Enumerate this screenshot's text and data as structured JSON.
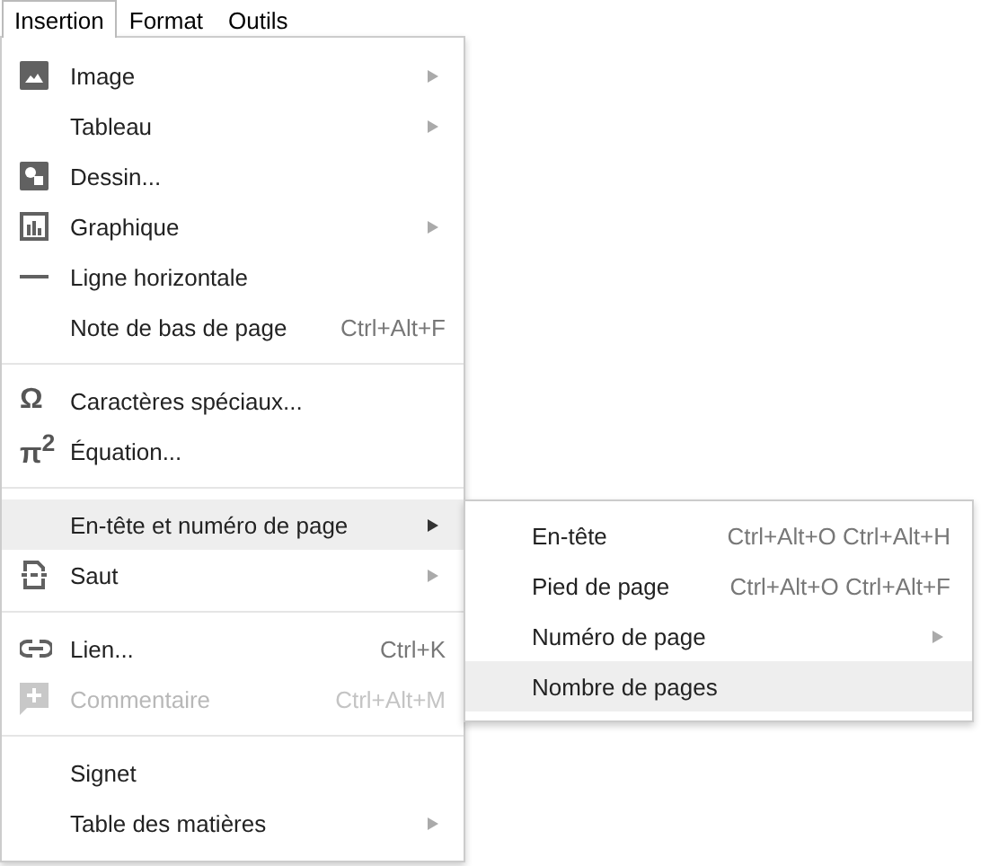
{
  "menubar": [
    {
      "label": "Insertion",
      "selected": true
    },
    {
      "label": "Format",
      "selected": false
    },
    {
      "label": "Outils",
      "selected": false
    }
  ],
  "menu": {
    "groups": [
      [
        {
          "label": "Image",
          "submenu": true,
          "selected": false,
          "disabled": false
        },
        {
          "label": "Tableau",
          "submenu": true,
          "selected": false,
          "disabled": false
        },
        {
          "label": "Dessin...",
          "submenu": false,
          "selected": false,
          "disabled": false
        },
        {
          "label": "Graphique",
          "submenu": true,
          "selected": false,
          "disabled": false
        },
        {
          "label": "Ligne horizontale",
          "submenu": false,
          "selected": false,
          "disabled": false
        },
        {
          "label": "Note de bas de page",
          "shortcut": "Ctrl+Alt+F",
          "submenu": false,
          "selected": false,
          "disabled": false
        }
      ],
      [
        {
          "label": "Caractères spéciaux...",
          "glyph": "Ω",
          "submenu": false,
          "selected": false,
          "disabled": false
        },
        {
          "label": "Équation...",
          "glyph": "π$^{2}$",
          "submenu": false,
          "selected": false,
          "disabled": false
        }
      ],
      [
        {
          "label": "En-tête et numéro de page",
          "submenu": true,
          "selected": true,
          "disabled": false
        },
        {
          "label": "Saut",
          "submenu": true,
          "selected": false,
          "disabled": false
        }
      ],
      [
        {
          "label": "Lien...",
          "shortcut": "Ctrl+K",
          "submenu": false,
          "selected": false,
          "disabled": false
        },
        {
          "label": "Commentaire",
          "shortcut": "Ctrl+Alt+M",
          "submenu": false,
          "selected": false,
          "disabled": true
        }
      ],
      [
        {
          "label": "Signet",
          "submenu": false,
          "selected": false,
          "disabled": false
        },
        {
          "label": "Table des matières",
          "submenu": true,
          "selected": false,
          "disabled": false
        }
      ]
    ]
  },
  "submenu": {
    "items": [
      {
        "label": "En-tête",
        "shortcut": "Ctrl+Alt+O Ctrl+Alt+H",
        "submenu": false,
        "selected": false
      },
      {
        "label": "Pied de page",
        "shortcut": "Ctrl+Alt+O Ctrl+Alt+F",
        "submenu": false,
        "selected": false
      },
      {
        "label": "Numéro de page",
        "submenu": true,
        "selected": false
      },
      {
        "label": "Nombre de pages",
        "submenu": false,
        "selected": true
      }
    ]
  }
}
